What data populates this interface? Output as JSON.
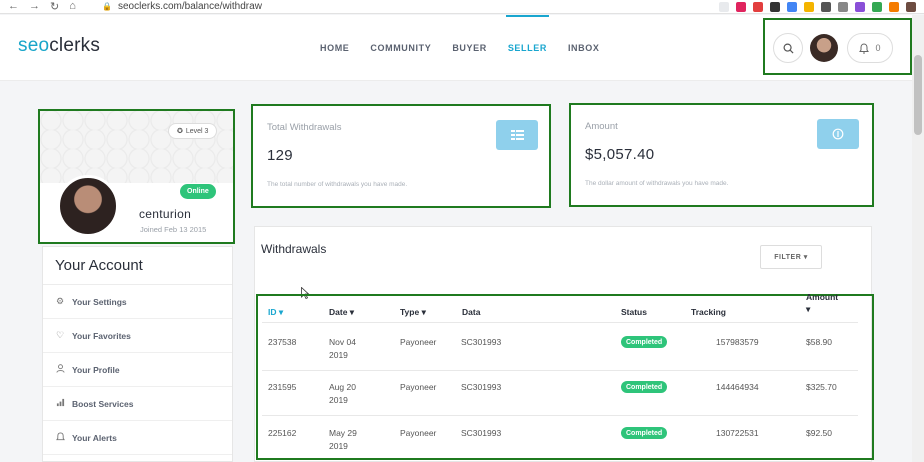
{
  "browser": {
    "url": "seoclerks.com/balance/withdraw",
    "nav": [
      "←",
      "→",
      "↻",
      "⌂"
    ],
    "extension_colors": [
      "#e8eaed",
      "#e0245e",
      "#e23e3e",
      "#333333",
      "#4285f4",
      "#f4b400",
      "#555555",
      "#888888",
      "#8a4fd8",
      "#34a853",
      "#f57c00",
      "#6d4c41"
    ]
  },
  "header": {
    "logo_seo": "seo",
    "logo_rest": "clerks",
    "nav": [
      "HOME",
      "COMMUNITY",
      "BUYER",
      "SELLER",
      "INBOX"
    ],
    "active_nav": "SELLER",
    "notifications_count": "0"
  },
  "profile": {
    "level": "Level 3",
    "status": "Online",
    "username": "centurion",
    "joined": "Joined Feb 13 2015"
  },
  "sidebar": {
    "title": "Your Account",
    "items": [
      {
        "icon": "gear-icon",
        "glyph": "⚙",
        "label": "Your Settings"
      },
      {
        "icon": "heart-icon",
        "glyph": "♡",
        "label": "Your Favorites"
      },
      {
        "icon": "user-icon",
        "glyph": "⍝",
        "label": "Your Profile"
      },
      {
        "icon": "bar-chart-icon",
        "glyph": "▮",
        "label": "Boost Services"
      },
      {
        "icon": "bell-icon",
        "glyph": "🔔",
        "label": "Your Alerts"
      }
    ]
  },
  "stats": {
    "total": {
      "label": "Total Withdrawals",
      "value": "129",
      "desc": "The total number of withdrawals you have made."
    },
    "amount": {
      "label": "Amount",
      "value": "$5,057.40",
      "desc": "The dollar amount of withdrawals you have made."
    }
  },
  "withdrawals": {
    "title": "Withdrawals",
    "filter_label": "FILTER ▾",
    "columns": {
      "id": "ID ▾",
      "date": "Date ▾",
      "type": "Type ▾",
      "data": "Data",
      "status": "Status",
      "tracking": "Tracking",
      "amount_line1": "Amount",
      "amount_line2": "▾"
    },
    "rows": [
      {
        "id": "237538",
        "date1": "Nov 04",
        "date2": "2019",
        "type": "Payoneer",
        "data": "SC301993",
        "status": "Completed",
        "tracking": "157983579",
        "amount": "$58.90"
      },
      {
        "id": "231595",
        "date1": "Aug 20",
        "date2": "2019",
        "type": "Payoneer",
        "data": "SC301993",
        "status": "Completed",
        "tracking": "144464934",
        "amount": "$325.70"
      },
      {
        "id": "225162",
        "date1": "May 29",
        "date2": "2019",
        "type": "Payoneer",
        "data": "SC301993",
        "status": "Completed",
        "tracking": "130722531",
        "amount": "$92.50"
      }
    ]
  },
  "colors": {
    "accent": "#19a6cf",
    "status_completed": "#2ec47a",
    "highlight_border": "#1f7a1f",
    "badge_bg": "#8fd0ec"
  }
}
